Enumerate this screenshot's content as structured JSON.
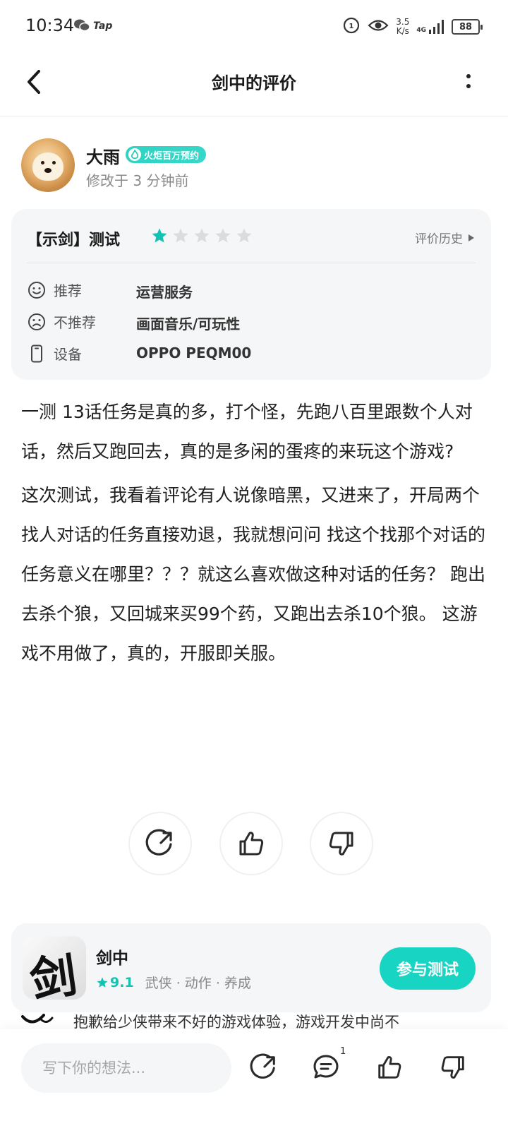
{
  "status_bar": {
    "time": "10:34",
    "app_label": "Tap",
    "speed_top": "3.5",
    "speed_bottom": "K/s",
    "network": "4G",
    "battery": "88"
  },
  "header": {
    "title": "剑中的评价"
  },
  "user": {
    "name": "大雨",
    "badge": "火炬百万预约",
    "edited_time": "修改于 3 分钟前"
  },
  "review_card": {
    "game_title": "【示剑】测试",
    "rating": 1,
    "max_rating": 5,
    "history_label": "评价历史",
    "rows": [
      {
        "label": "推荐",
        "value": "运营服务"
      },
      {
        "label": "不推荐",
        "value": "画面音乐/可玩性"
      },
      {
        "label": "设备",
        "value": "OPPO PEQM00"
      }
    ]
  },
  "review_body": {
    "paragraphs": [
      "一测 13话任务是真的多，打个怪，先跑八百里跟数个人对话，然后又跑回去，真的是多闲的蛋疼的来玩这个游戏?",
      "这次测试，我看着评论有人说像暗黑，又进来了，开局两个找人对话的任务直接劝退，我就想问问 找这个找那个对话的任务意义在哪里？？？就这么喜欢做这种对话的任务？ 跑出去杀个狼，又回城来买99个药，又跑出去杀10个狼。 这游戏不用做了，真的，开服即关服。"
    ]
  },
  "game_card": {
    "name": "剑中",
    "icon_char": "剑",
    "score": "9.1",
    "tags": "武侠 · 动作 · 养成",
    "join_label": "参与测试"
  },
  "dev_reply": {
    "text": "抱歉给少侠带来不好的游戏体验，游戏开发中尚不"
  },
  "bottom_bar": {
    "input_placeholder": "写下你的想法...",
    "comment_count": "1"
  },
  "colors": {
    "accent": "#18d4c3",
    "star_on": "#14c2b4",
    "star_off": "#dcdcdc",
    "card_bg": "#f5f6f7"
  }
}
